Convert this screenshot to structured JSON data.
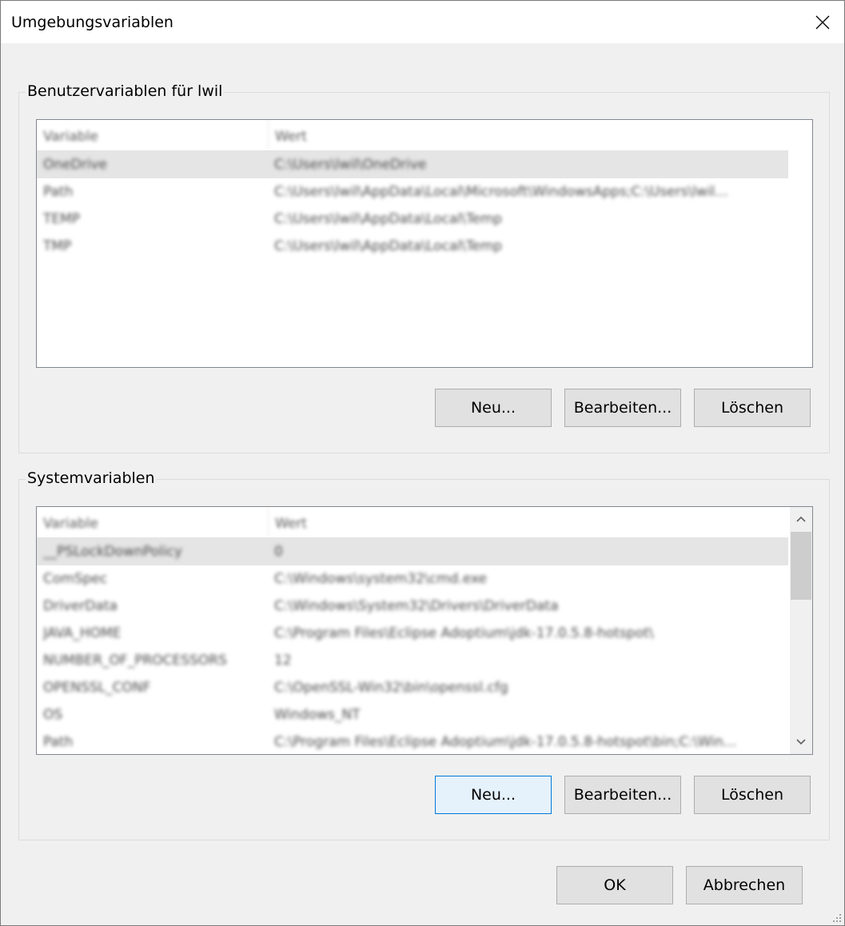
{
  "window": {
    "title": "Umgebungsvariablen",
    "close_icon": "close-icon"
  },
  "user_vars": {
    "group_label": "Benutzervariablen für lwil",
    "columns": [
      "Variable",
      "Wert"
    ],
    "rows": [
      {
        "variable": "OneDrive",
        "value": "C:\\Users\\lwil\\OneDrive",
        "selected": true
      },
      {
        "variable": "Path",
        "value": "C:\\Users\\lwil\\AppData\\Local\\Microsoft\\WindowsApps;C:\\Users\\lwil...",
        "selected": false
      },
      {
        "variable": "TEMP",
        "value": "C:\\Users\\lwil\\AppData\\Local\\Temp",
        "selected": false
      },
      {
        "variable": "TMP",
        "value": "C:\\Users\\lwil\\AppData\\Local\\Temp",
        "selected": false
      }
    ],
    "buttons": {
      "new": "Neu...",
      "edit": "Bearbeiten...",
      "delete": "Löschen"
    }
  },
  "system_vars": {
    "group_label": "Systemvariablen",
    "columns": [
      "Variable",
      "Wert"
    ],
    "rows": [
      {
        "variable": "__PSLockDownPolicy",
        "value": "0",
        "selected": true
      },
      {
        "variable": "ComSpec",
        "value": "C:\\Windows\\system32\\cmd.exe",
        "selected": false
      },
      {
        "variable": "DriverData",
        "value": "C:\\Windows\\System32\\Drivers\\DriverData",
        "selected": false
      },
      {
        "variable": "JAVA_HOME",
        "value": "C:\\Program Files\\Eclipse Adoptium\\jdk-17.0.5.8-hotspot\\",
        "selected": false
      },
      {
        "variable": "NUMBER_OF_PROCESSORS",
        "value": "12",
        "selected": false
      },
      {
        "variable": "OPENSSL_CONF",
        "value": "C:\\OpenSSL-Win32\\bin\\openssl.cfg",
        "selected": false
      },
      {
        "variable": "OS",
        "value": "Windows_NT",
        "selected": false
      },
      {
        "variable": "Path",
        "value": "C:\\Program Files\\Eclipse Adoptium\\jdk-17.0.5.8-hotspot\\bin;C:\\Win...",
        "selected": false
      }
    ],
    "buttons": {
      "new": "Neu...",
      "edit": "Bearbeiten...",
      "delete": "Löschen"
    },
    "scroll_up_icon": "chevron-up-icon",
    "scroll_down_icon": "chevron-down-icon"
  },
  "footer": {
    "ok": "OK",
    "cancel": "Abbrechen"
  },
  "colors": {
    "dialog_bg": "#f0f0f0",
    "titlebar_bg": "#ffffff",
    "selected_row": "#e5e5e5",
    "focus_border": "#0078d7",
    "focus_bg": "#e5f1fb",
    "button_bg": "#e1e1e1"
  }
}
